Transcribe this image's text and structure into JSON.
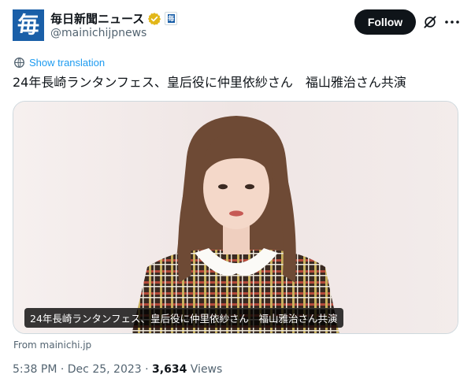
{
  "account": {
    "display_name": "毎日新聞ニュース",
    "handle": "@mainichijpnews",
    "avatar_glyph": "毎",
    "avatar_color": "#1a5fa8",
    "verified_badge_color": "#e2b719",
    "affiliate_glyph": "毎"
  },
  "actions": {
    "follow_label": "Follow"
  },
  "icons": {
    "verified": "verified-gold-badge-icon",
    "affiliate": "affiliate-badge-icon",
    "grok": "grok-icon",
    "more": "more-options-icon",
    "translate": "translate-icon"
  },
  "tweet": {
    "show_translation": "Show translation",
    "text": "24年長崎ランタンフェス、皇后役に仲里依紗さん　福山雅治さん共演",
    "media_caption": "24年長崎ランタンフェス、皇后役に仲里依紗さん　福山雅治さん共演",
    "source": "From mainichi.jp",
    "time": "5:38 PM",
    "date": "Dec 25, 2023",
    "separator": "·",
    "views_count": "3,634",
    "views_label": "Views"
  }
}
